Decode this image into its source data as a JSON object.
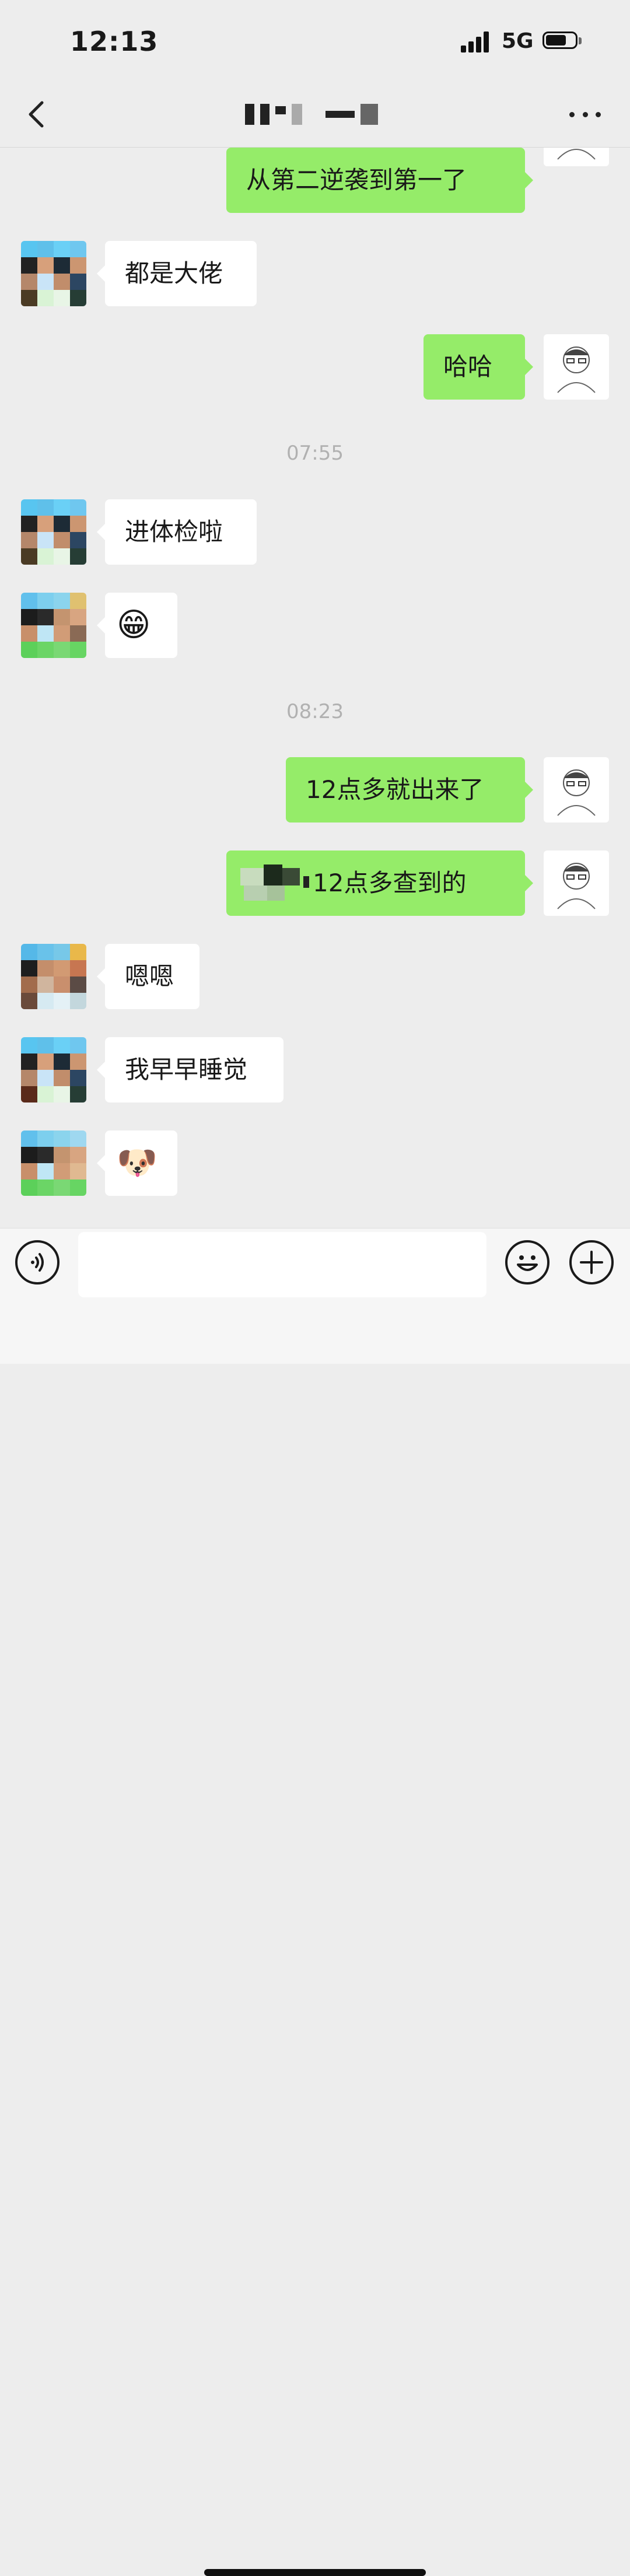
{
  "status_bar": {
    "time": "12:13",
    "network": "5G"
  },
  "chat": {
    "messages": [
      {
        "side": "out",
        "text": "从第二逆袭到第一了"
      },
      {
        "side": "in",
        "text": "都是大佬"
      },
      {
        "side": "out",
        "text": "哈哈"
      },
      {
        "type": "time",
        "text": "07:55"
      },
      {
        "side": "in",
        "text": "进体检啦"
      },
      {
        "side": "in",
        "text": "😁"
      },
      {
        "type": "time",
        "text": "08:23"
      },
      {
        "side": "out",
        "text": "12点多就出来了"
      },
      {
        "side": "out",
        "text": "12点多查到的",
        "note_prefix_redacted": true
      },
      {
        "side": "in",
        "text": "嗯嗯"
      },
      {
        "side": "in",
        "text": "我早早睡觉"
      },
      {
        "side": "in",
        "text": "🐶"
      }
    ]
  },
  "input": {
    "value": "",
    "placeholder": ""
  },
  "colors": {
    "background": "#ededed",
    "outgoing_bubble": "#95ec69",
    "incoming_bubble": "#ffffff",
    "timestamp": "#b1b1b1"
  },
  "icons": {
    "back": "chevron-left-icon",
    "more": "more-icon",
    "voice": "voice-icon",
    "emoji": "emoji-icon",
    "plus": "plus-icon"
  }
}
